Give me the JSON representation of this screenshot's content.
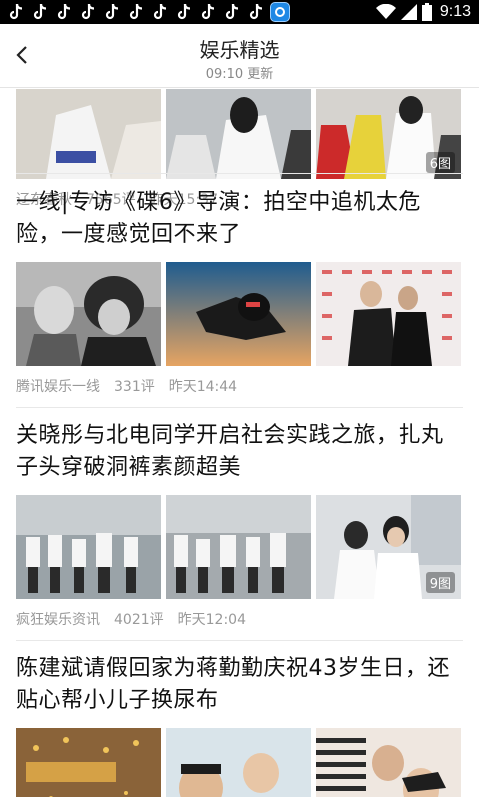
{
  "status_bar": {
    "time": "9:13",
    "notification_icons": [
      "tiktok-icon",
      "tiktok-icon",
      "tiktok-icon",
      "tiktok-icon",
      "tiktok-icon",
      "tiktok-icon",
      "tiktok-icon",
      "tiktok-icon",
      "tiktok-icon",
      "tiktok-icon",
      "tiktok-icon",
      "app-icon"
    ]
  },
  "header": {
    "title": "娱乐精选",
    "subtitle": "09:10 更新"
  },
  "articles": [
    {
      "title": "",
      "source": "辽东春秋",
      "comments": "7565评",
      "time": "昨天15:37",
      "image_count": "6图"
    },
    {
      "title": "一线|专访《碟6》导演：拍空中追机太危险，一度感觉回不来了",
      "source": "腾讯娱乐一线",
      "comments": "331评",
      "time": "昨天14:44",
      "image_count": ""
    },
    {
      "title": "关晓彤与北电同学开启社会实践之旅，扎丸子头穿破洞裤素颜超美",
      "source": "疯狂娱乐资讯",
      "comments": "4021评",
      "time": "昨天12:04",
      "image_count": "9图"
    },
    {
      "title": "陈建斌请假回家为蒋勤勤庆祝43岁生日，还贴心帮小儿子换尿布",
      "source": "",
      "comments": "",
      "time": "",
      "image_count": ""
    }
  ],
  "colors": {
    "status_bar_bg": "#000000",
    "meta_text": "#999999",
    "divider": "#e8e8e8",
    "title_text": "#111111"
  }
}
